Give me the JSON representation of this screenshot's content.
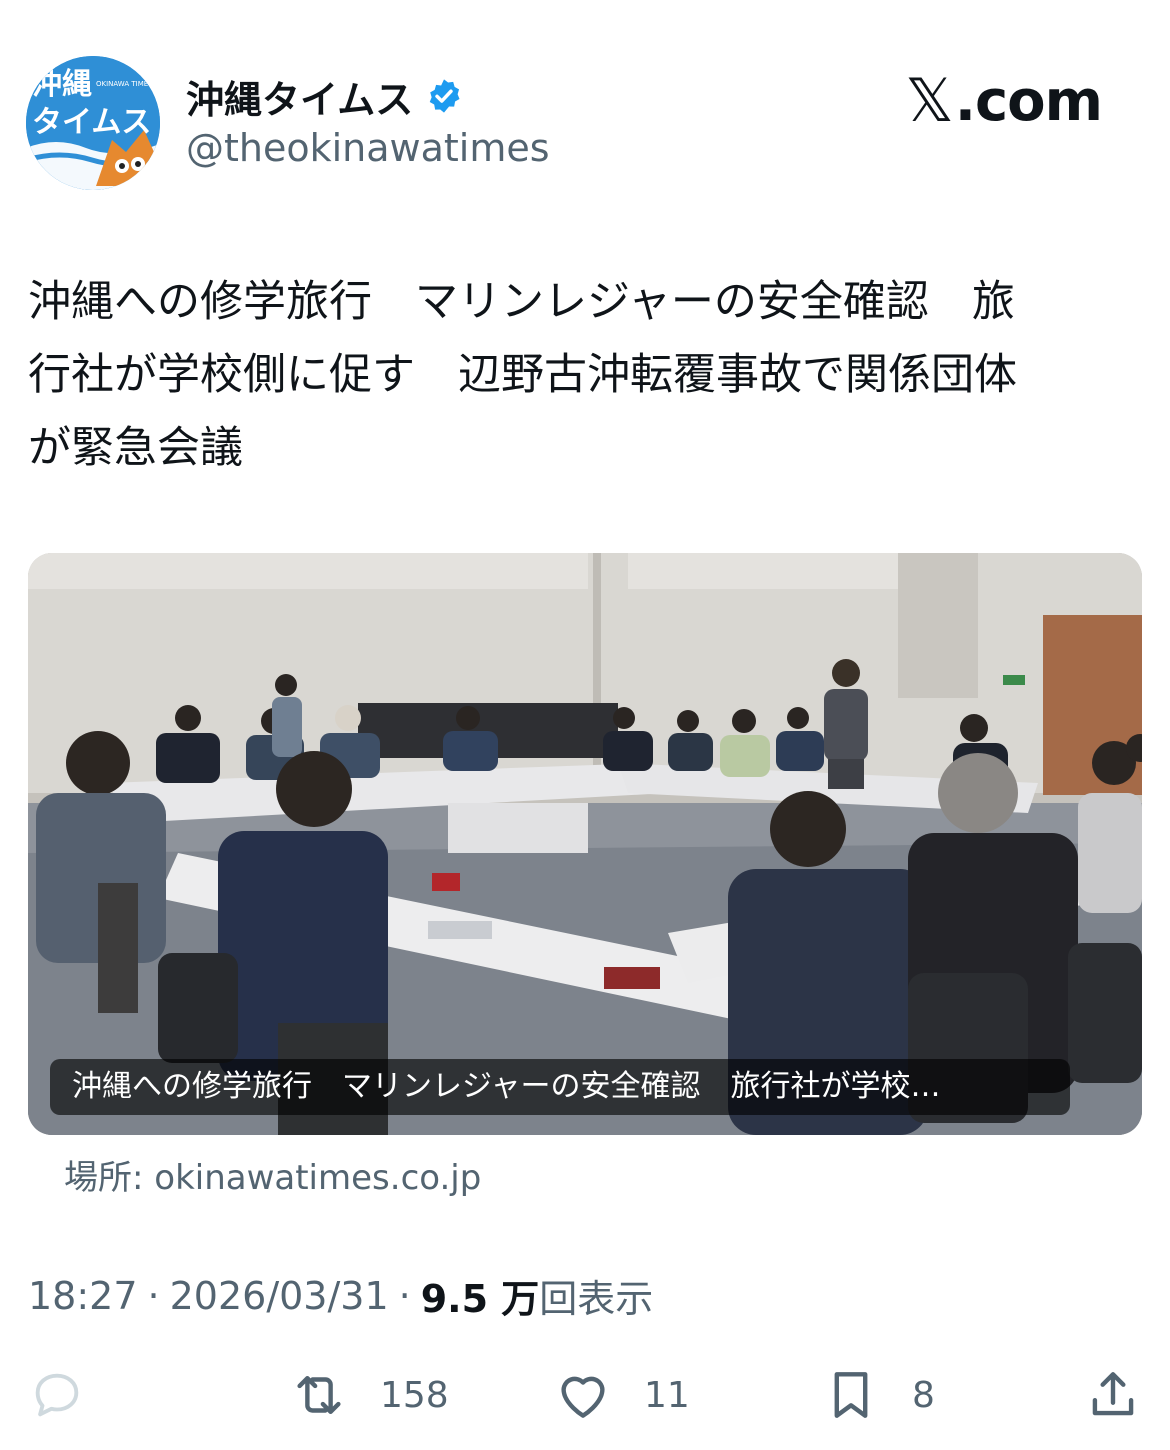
{
  "account": {
    "display_name": "沖縄タイムス",
    "handle": "@theokinawatimes",
    "verified_icon": "verified-badge-icon",
    "avatar_text_line1": "沖縄",
    "avatar_text_line2": "タイムス",
    "avatar_small_text": "OKINAWA TIMES"
  },
  "brand": {
    "site": ".com",
    "x_glyph": "𝕏"
  },
  "tweet": {
    "text": "沖縄への修学旅行　マリンレジャーの安全確認　旅\n行社が学校側に促す　辺野古沖転覆事故で関係団体\nが緊急会議"
  },
  "link_card": {
    "caption": "沖縄への修学旅行　マリンレジャーの安全確認　旅行社が学校…",
    "source_label": "場所: okinawatimes.co.jp"
  },
  "meta": {
    "time": "18:27",
    "date": "2026/03/31",
    "views_count": "9.5 万",
    "views_label": "回表示",
    "separator": "·"
  },
  "actions": {
    "reply_count": "",
    "retweet_count": "158",
    "like_count": "11",
    "bookmark_count": "8"
  },
  "colors": {
    "text": "#0f1419",
    "secondary": "#536471",
    "verified": "#1d9bf0",
    "avatar_blue": "#2f8fd6"
  }
}
